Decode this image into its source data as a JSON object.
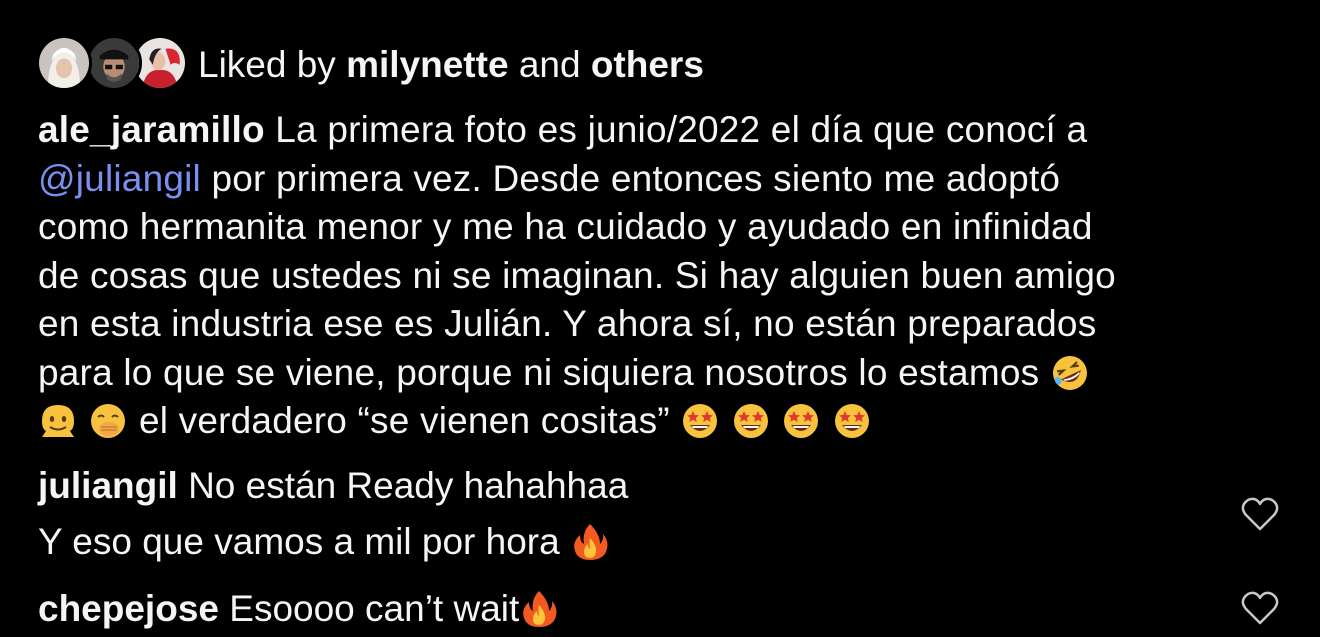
{
  "likes": {
    "prefix": "Liked by",
    "user": "milynette",
    "joiner": "and",
    "others": "others",
    "avatars": [
      "avatar-user-1",
      "avatar-user-2",
      "avatar-user-3"
    ]
  },
  "caption": {
    "username": "ale_jaramillo",
    "line1": "La primera foto es junio/2022 el día que conocí a",
    "mention": "@juliangil",
    "line2": "por primera vez. Desde entonces siento me adoptó",
    "line3": "como hermanita menor y me ha cuidado y ayudado en infinidad",
    "line4": "de cosas que ustedes ni se imaginan. Si hay alguien buen amigo",
    "line5": "en esta industria ese es Julián. Y ahora sí, no están preparados",
    "line6": "para lo que se viene, porque ni siquiera nosotros lo estamos",
    "line7": "el verdadero “se vienen cositas”",
    "emojis": [
      "rofl-emoji",
      "melting-face-emoji",
      "hand-over-mouth-emoji",
      "star-struck-emoji"
    ]
  },
  "comments": [
    {
      "username": "juliangil",
      "line1": "No están Ready hahahhaa",
      "line2": "Y eso que vamos a mil por hora",
      "emoji": "fire-emoji"
    },
    {
      "username": "chepejose",
      "text": "Esoooo can’t wait",
      "emoji": "fire-emoji"
    }
  ],
  "colors": {
    "background": "#000000",
    "text": "#f5f5f5",
    "mention": "#7b8ff0"
  }
}
